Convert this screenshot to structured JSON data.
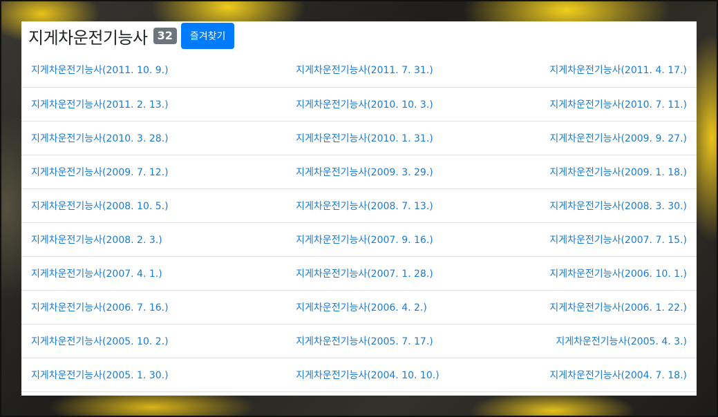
{
  "header": {
    "title": "지게차운전기능사",
    "count": "32",
    "favorite_label": "즐겨찾기"
  },
  "colors": {
    "link": "#1a7bd2",
    "badge": "#6c757d",
    "button": "#007bff"
  },
  "rows": [
    [
      "지게차운전기능사(2011. 10. 9.)",
      "지게차운전기능사(2011. 7. 31.)",
      "지게차운전기능사(2011. 4. 17.)"
    ],
    [
      "지게차운전기능사(2011. 2. 13.)",
      "지게차운전기능사(2010. 10. 3.)",
      "지게차운전기능사(2010. 7. 11.)"
    ],
    [
      "지게차운전기능사(2010. 3. 28.)",
      "지게차운전기능사(2010. 1. 31.)",
      "지게차운전기능사(2009. 9. 27.)"
    ],
    [
      "지게차운전기능사(2009. 7. 12.)",
      "지게차운전기능사(2009. 3. 29.)",
      "지게차운전기능사(2009. 1. 18.)"
    ],
    [
      "지게차운전기능사(2008. 10. 5.)",
      "지게차운전기능사(2008. 7. 13.)",
      "지게차운전기능사(2008. 3. 30.)"
    ],
    [
      "지게차운전기능사(2008. 2. 3.)",
      "지게차운전기능사(2007. 9. 16.)",
      "지게차운전기능사(2007. 7. 15.)"
    ],
    [
      "지게차운전기능사(2007. 4. 1.)",
      "지게차운전기능사(2007. 1. 28.)",
      "지게차운전기능사(2006. 10. 1.)"
    ],
    [
      "지게차운전기능사(2006. 7. 16.)",
      "지게차운전기능사(2006. 4. 2.)",
      "지게차운전기능사(2006. 1. 22.)"
    ],
    [
      "지게차운전기능사(2005. 10. 2.)",
      "지게차운전기능사(2005. 7. 17.)",
      "지게차운전기능사(2005. 4. 3.)"
    ],
    [
      "지게차운전기능사(2005. 1. 30.)",
      "지게차운전기능사(2004. 10. 10.)",
      "지게차운전기능사(2004. 7. 18.)"
    ]
  ]
}
